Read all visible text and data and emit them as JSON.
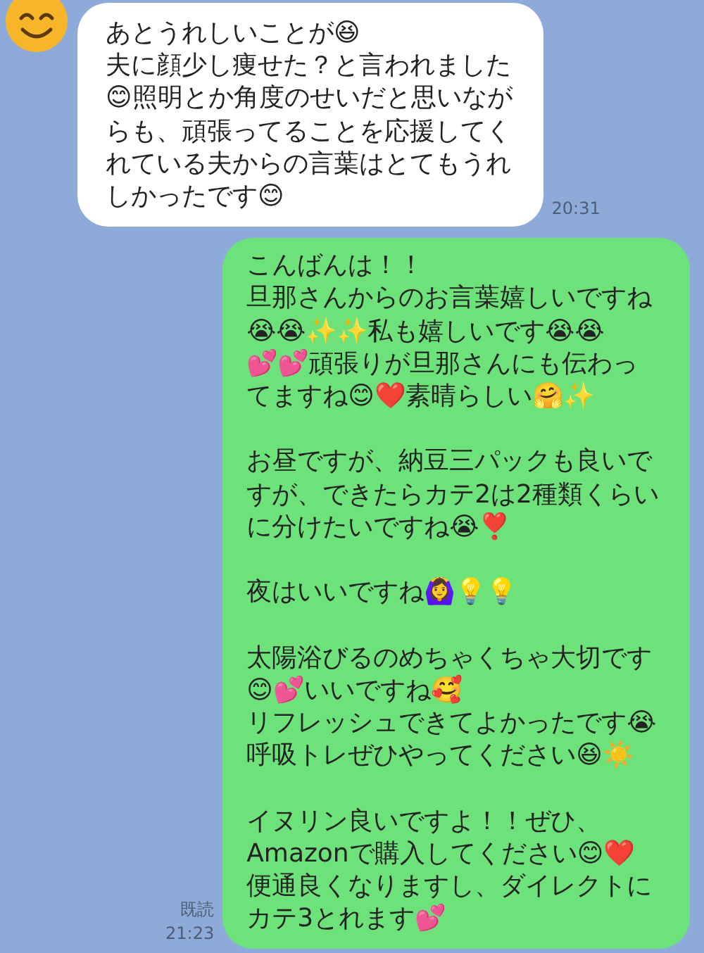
{
  "messages": [
    {
      "kind": "received",
      "paragraphs": [
        [
          "あとうれしいことが😆",
          "夫に顔少し痩せた？と言われました",
          "😊照明とか角度のせいだと思いなが",
          "らも、頑張ってることを応援してく",
          "れている夫からの言葉はとてもうれ",
          "しかったです😊"
        ]
      ],
      "time": "20:31"
    },
    {
      "kind": "sent",
      "paragraphs": [
        [
          "こんばんは！！",
          "旦那さんからのお言葉嬉しいですね",
          "😭😭✨✨私も嬉しいです😭😭",
          "💕💕頑張りが旦那さんにも伝わっ",
          "てますね😊❤️素晴らしい🤗✨"
        ],
        [
          "お昼ですが、納豆三パックも良いで",
          "すが、できたらカテ2は2種類くらい",
          "に分けたいですね😭❣️"
        ],
        [
          "夜はいいですね🙆‍♀️💡💡"
        ],
        [
          "太陽浴びるのめちゃくちゃ大切です",
          "😊💕いいですね🥰",
          "リフレッシュできてよかったです😭",
          "呼吸トレぜひやってください😆☀️"
        ],
        [
          "イヌリン良いですよ！！ぜひ、",
          "Amazonで購入してください😊❤️",
          "便通良くなりますし、ダイレクトに",
          "カテ3とれます💕"
        ]
      ],
      "read": "既読",
      "time": "21:23"
    }
  ]
}
